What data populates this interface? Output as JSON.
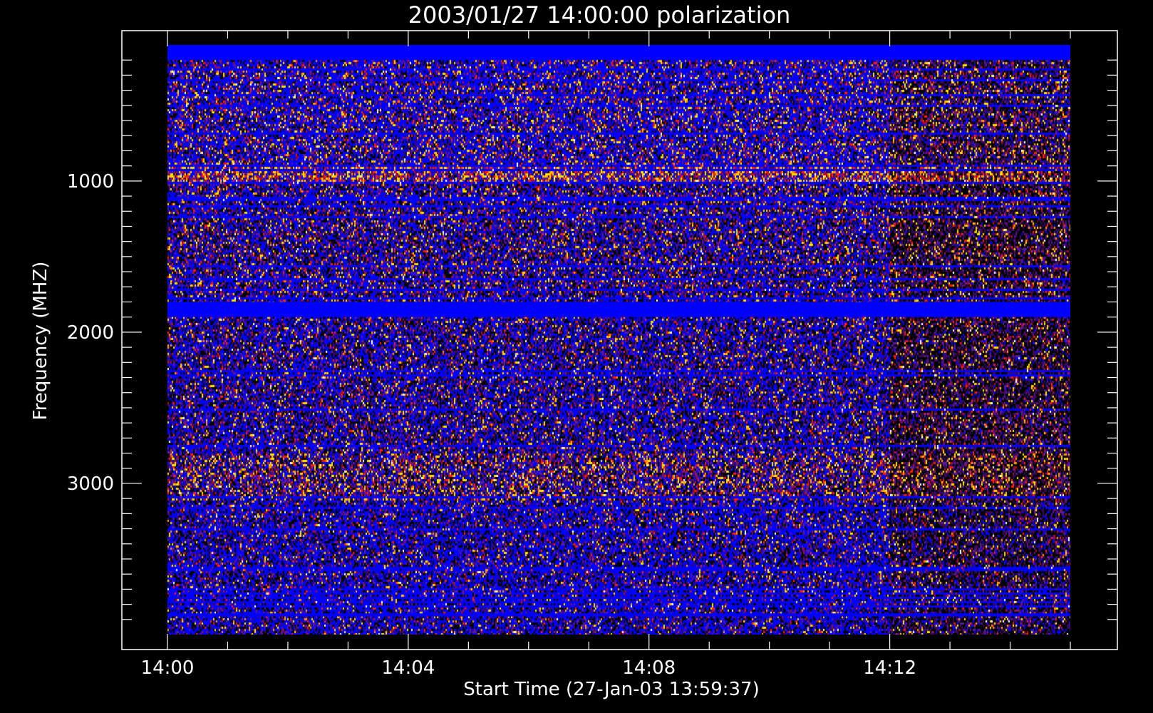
{
  "chart_data": {
    "type": "heatmap",
    "title": "2003/01/27 14:00:00 polarization",
    "xlabel": "Start Time (27-Jan-03 13:59:37)",
    "ylabel": "Frequency (MHZ)",
    "x_tick_labels": [
      "14:00",
      "14:04",
      "14:08",
      "14:12"
    ],
    "x_ticks_minutes": [
      0,
      4,
      8,
      12
    ],
    "x_range_minutes": [
      0,
      15
    ],
    "y_tick_labels": [
      "1000",
      "2000",
      "3000"
    ],
    "y_ticks_mhz": [
      1000,
      2000,
      3000
    ],
    "y_range_mhz": [
      100,
      4000
    ],
    "y_axis_inverted": true,
    "colormap": [
      "#000000",
      "#3a0a5a",
      "#5a1a9a",
      "#0000ff",
      "#b01020",
      "#ff2000",
      "#ff9a00",
      "#ffe000",
      "#ffffff"
    ],
    "notable_bands_mhz": [
      {
        "range": [
          100,
          200
        ],
        "color": "#0000ff"
      },
      {
        "range": [
          1800,
          1900
        ],
        "color": "#0000ff"
      },
      {
        "range": [
          3860,
          3880
        ],
        "color": "#0000ff"
      }
    ],
    "grid": false,
    "legend": "none"
  }
}
